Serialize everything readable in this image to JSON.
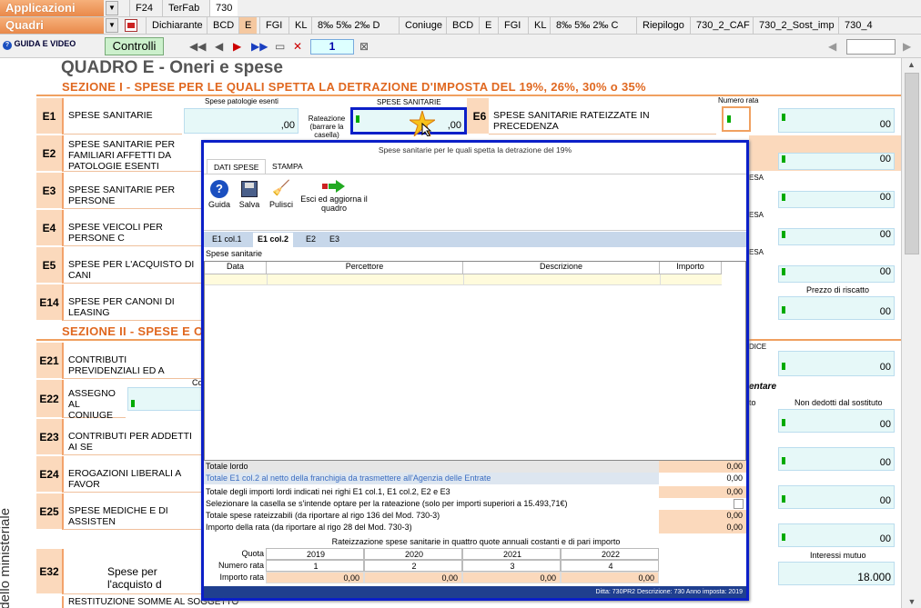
{
  "topbar": {
    "app_button": "Applicazioni",
    "quadri_button": "Quadri",
    "tabs_row1": [
      "F24",
      "TerFab",
      "730"
    ],
    "tabs_row2": [
      "Dichiarante",
      "BCD",
      "E",
      "FGI",
      "KL",
      "8‰ 5‰ 2‰ D",
      "Coniuge",
      "BCD",
      "E",
      "FGI",
      "KL",
      "8‰ 5‰ 2‰ C",
      "Riepilogo",
      "730_2_CAF",
      "730_2_Sost_imp",
      "730_4"
    ]
  },
  "toolbar": {
    "guida_video": "GUIDA E VIDEO",
    "controlli": "Controlli",
    "page": "1"
  },
  "form": {
    "title": "QUADRO E - Oneri e spese",
    "section1": "SEZIONE I - SPESE PER LE QUALI SPETTA LA DETRAZIONE D'IMPOSTA DEL 19%, 26%, 30% o 35%",
    "section2": "SEZIONE II - SPESE E O",
    "rows": [
      {
        "code": "E1",
        "label": "SPESE SANITARIE"
      },
      {
        "code": "E2",
        "label": "SPESE SANITARIE PER FAMILIARI AFFETTI DA PATOLOGIE ESENTI"
      },
      {
        "code": "E3",
        "label": "SPESE SANITARIE PER PERSONE"
      },
      {
        "code": "E4",
        "label": "SPESE VEICOLI PER PERSONE C"
      },
      {
        "code": "E5",
        "label": "SPESE PER L'ACQUISTO DI CANI"
      },
      {
        "code": "E14",
        "label": "SPESE PER CANONI DI LEASING"
      },
      {
        "code": "E21",
        "label": "CONTRIBUTI PREVIDENZIALI ED A"
      },
      {
        "code": "E22",
        "label": "ASSEGNO AL CONIUGE"
      },
      {
        "code": "E23",
        "label": "CONTRIBUTI PER ADDETTI AI SE"
      },
      {
        "code": "E24",
        "label": "EROGAZIONI LIBERALI A FAVOR"
      },
      {
        "code": "E25",
        "label": "SPESE MEDICHE E DI ASSISTEN"
      },
      {
        "code": "E32",
        "label": "Spese per l'acquisto d"
      }
    ],
    "e1": {
      "patologie_label": "Spese patologie esenti",
      "sanitarie_label": "SPESE SANITARIE",
      "rateazione_label": "Rateazione (barrare la casella)",
      "zero": ",00",
      "e6_code": "E6",
      "e6_label": "SPESE SANITARIE RATEIZZATE IN PRECEDENZA",
      "numero_rata": "Numero rata",
      "zero2": "00"
    },
    "right_labels": {
      "esa": "ESA",
      "prezzo_riscatto": "Prezzo di riscatto",
      "codice": "DICE",
      "entare": "entare",
      "to": "to",
      "non_dedotti": "Non dedotti dal sostituto",
      "interessi": "Interessi mutuo",
      "interessi_val": "18.000",
      "zero": "00"
    },
    "e32_bottom": "RESTITUZIONE SOMME AL SOGGETTO EROGATORE",
    "co": "Co",
    "side_text": "odello ministeriale"
  },
  "dialog": {
    "title": "Spese sanitarie per le quali spetta la detrazione del 19%",
    "ribbon_tabs": [
      "DATI SPESE",
      "STAMPA"
    ],
    "buttons": {
      "guida": "Guida",
      "salva": "Salva",
      "pulisci": "Pulisci",
      "esci": "Esci ed aggiorna il quadro"
    },
    "sub_tabs": [
      "E1 col.1",
      "E1 col.2",
      "E2",
      "E3"
    ],
    "grid_title": "Spese sanitarie",
    "columns": [
      "Data",
      "Percettore",
      "Descrizione",
      "Importo"
    ],
    "totale_lordo": "Totale lordo",
    "totale_lordo_val": "0,00",
    "totale_netto": "Totale E1 col.2 al netto della franchigia da trasmettere all'Agenzia delle Entrate",
    "totale_netto_val": "0,00",
    "totale_importi": "Totale degli importi lordi indicati nei righi E1 col.1, E1 col.2, E2 e E3",
    "totale_importi_val": "0,00",
    "seleziona": "Selezionare la casella se s'intende optare per la rateazione (solo per importi superiori a 15.493,71€)",
    "totale_rateizzabili": "Totale spese rateizzabili (da riportare al rigo 136 del Mod. 730-3)",
    "totale_rateizzabili_val": "0,00",
    "importo_rata": "Importo della rata (da riportare al rigo 28 del Mod. 730-3)",
    "importo_rata_val": "0,00",
    "rateizzazione_title": "Rateizzazione spese sanitarie in quattro quote annuali costanti e di pari importo",
    "quota_label": "Quota",
    "numero_rata_label": "Numero rata",
    "importo_rata_label": "Importo rata",
    "years": [
      "2019",
      "2020",
      "2021",
      "2022"
    ],
    "rate_numbers": [
      "1",
      "2",
      "3",
      "4"
    ],
    "rate_values": [
      "0,00",
      "0,00",
      "0,00",
      "0,00"
    ],
    "status": "Ditta: 730PR2   Descrizione: 730   Anno imposta: 2019"
  }
}
